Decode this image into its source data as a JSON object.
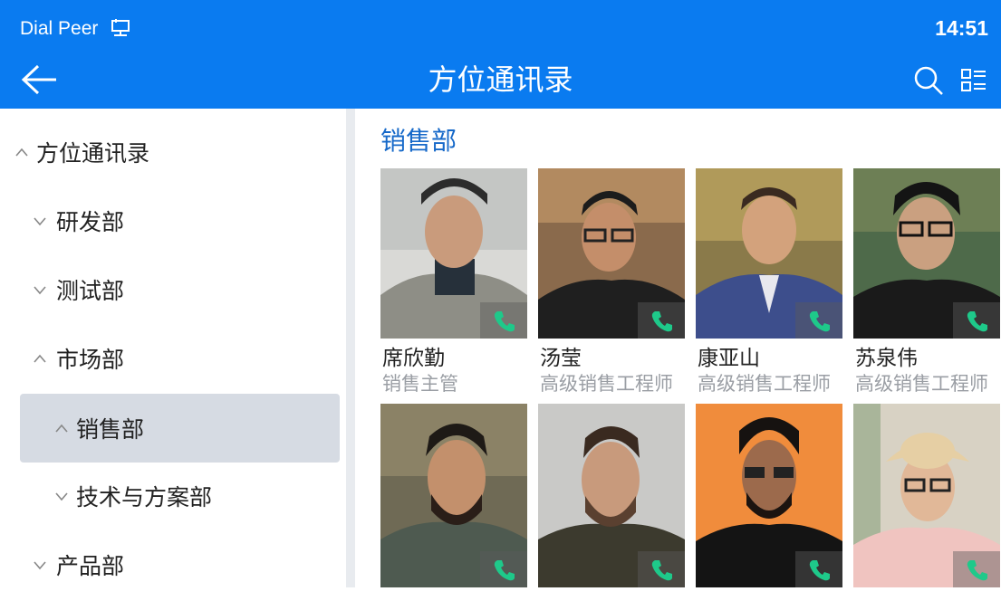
{
  "status_bar": {
    "carrier": "Dial Peer",
    "carrier_icon": "network-icon",
    "time": "14:51"
  },
  "header": {
    "title": "方位通讯录",
    "back_icon": "arrow-left-icon",
    "search_icon": "search-icon",
    "view_icon": "list-view-icon"
  },
  "colors": {
    "header_bg": "#0a7bf0",
    "accent": "#1669c9",
    "call_green": "#1ec98a",
    "selected_bg": "#d6dbe3"
  },
  "sidebar": {
    "items": [
      {
        "label": "方位通讯录",
        "expanded": true
      },
      {
        "label": "研发部",
        "expanded": false
      },
      {
        "label": "测试部",
        "expanded": false
      },
      {
        "label": "市场部",
        "expanded": true
      },
      {
        "label": "销售部",
        "expanded": true,
        "selected": true
      },
      {
        "label": "技术与方案部",
        "expanded": false
      },
      {
        "label": "产品部",
        "expanded": false
      }
    ]
  },
  "main": {
    "department": "销售部",
    "contacts": [
      {
        "name": "席欣勤",
        "title": "销售主管"
      },
      {
        "name": "汤莹",
        "title": "高级销售工程师"
      },
      {
        "name": "康亚山",
        "title": "高级销售工程师"
      },
      {
        "name": "苏泉伟",
        "title": "高级销售工程师"
      },
      {
        "name": "",
        "title": ""
      },
      {
        "name": "",
        "title": ""
      },
      {
        "name": "",
        "title": ""
      },
      {
        "name": "",
        "title": ""
      }
    ]
  }
}
